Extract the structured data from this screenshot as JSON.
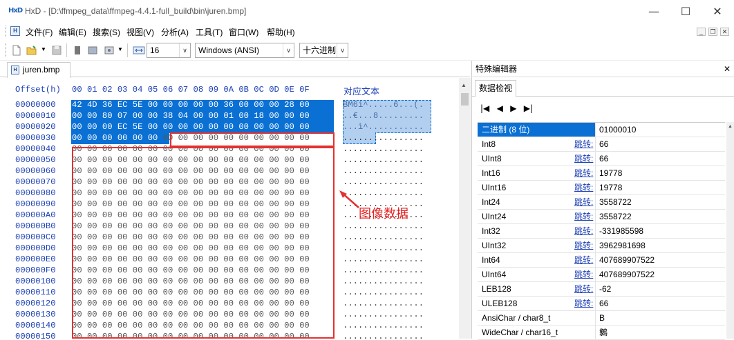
{
  "window": {
    "icon_label": "HxD",
    "title": "HxD - [D:\\ffmpeg_data\\ffmpeg-4.4.1-full_build\\bin\\juren.bmp]",
    "min_glyph": "—",
    "max_glyph": "☐",
    "close_glyph": "✕"
  },
  "menu": {
    "items": [
      "文件(F)",
      "编辑(E)",
      "搜索(S)",
      "视图(V)",
      "分析(A)",
      "工具(T)",
      "窗口(W)",
      "帮助(H)"
    ]
  },
  "toolbar": {
    "bytes_per_row": "16",
    "charset": "Windows (ANSI)",
    "offset_base": "十六进制"
  },
  "tab": {
    "filename": "juren.bmp"
  },
  "hex": {
    "header_offset": "Offset(h)",
    "header_columns": "00 01 02 03 04 05 06 07 08 09 0A 0B 0C 0D 0E 0F",
    "header_text": "对应文本",
    "rows": [
      {
        "offset": "00000000",
        "bytes": "42 4D 36 EC 5E 00 00 00 00 00 36 00 00 00 28 00",
        "ascii": "BM6ì^.....6...(."
      },
      {
        "offset": "00000010",
        "bytes": "00 00 80 07 00 00 38 04 00 00 01 00 18 00 00 00",
        "ascii": "..€...8........."
      },
      {
        "offset": "00000020",
        "bytes": "00 00 00 EC 5E 00 00 00 00 00 00 00 00 00 00 00",
        "ascii": "...ì^..........."
      },
      {
        "offset": "00000030",
        "bytes": "00 00 00 00 00 00 00 00 00 00 00 00 00 00 00 00",
        "ascii": "................"
      },
      {
        "offset": "00000040",
        "bytes": "00 00 00 00 00 00 00 00 00 00 00 00 00 00 00 00",
        "ascii": "................"
      },
      {
        "offset": "00000050",
        "bytes": "00 00 00 00 00 00 00 00 00 00 00 00 00 00 00 00",
        "ascii": "................"
      },
      {
        "offset": "00000060",
        "bytes": "00 00 00 00 00 00 00 00 00 00 00 00 00 00 00 00",
        "ascii": "................"
      },
      {
        "offset": "00000070",
        "bytes": "00 00 00 00 00 00 00 00 00 00 00 00 00 00 00 00",
        "ascii": "................"
      },
      {
        "offset": "00000080",
        "bytes": "00 00 00 00 00 00 00 00 00 00 00 00 00 00 00 00",
        "ascii": "................"
      },
      {
        "offset": "00000090",
        "bytes": "00 00 00 00 00 00 00 00 00 00 00 00 00 00 00 00",
        "ascii": "................"
      },
      {
        "offset": "000000A0",
        "bytes": "00 00 00 00 00 00 00 00 00 00 00 00 00 00 00 00",
        "ascii": "................"
      },
      {
        "offset": "000000B0",
        "bytes": "00 00 00 00 00 00 00 00 00 00 00 00 00 00 00 00",
        "ascii": "................"
      },
      {
        "offset": "000000C0",
        "bytes": "00 00 00 00 00 00 00 00 00 00 00 00 00 00 00 00",
        "ascii": "................"
      },
      {
        "offset": "000000D0",
        "bytes": "00 00 00 00 00 00 00 00 00 00 00 00 00 00 00 00",
        "ascii": "................"
      },
      {
        "offset": "000000E0",
        "bytes": "00 00 00 00 00 00 00 00 00 00 00 00 00 00 00 00",
        "ascii": "................"
      },
      {
        "offset": "000000F0",
        "bytes": "00 00 00 00 00 00 00 00 00 00 00 00 00 00 00 00",
        "ascii": "................"
      },
      {
        "offset": "00000100",
        "bytes": "00 00 00 00 00 00 00 00 00 00 00 00 00 00 00 00",
        "ascii": "................"
      },
      {
        "offset": "00000110",
        "bytes": "00 00 00 00 00 00 00 00 00 00 00 00 00 00 00 00",
        "ascii": "................"
      },
      {
        "offset": "00000120",
        "bytes": "00 00 00 00 00 00 00 00 00 00 00 00 00 00 00 00",
        "ascii": "................"
      },
      {
        "offset": "00000130",
        "bytes": "00 00 00 00 00 00 00 00 00 00 00 00 00 00 00 00",
        "ascii": "................"
      },
      {
        "offset": "00000140",
        "bytes": "00 00 00 00 00 00 00 00 00 00 00 00 00 00 00 00",
        "ascii": "................"
      },
      {
        "offset": "00000150",
        "bytes": "00 00 00 00 00 00 00 00 00 00 00 00 00 00 00 00",
        "ascii": "................"
      }
    ],
    "annotation": "图像数据"
  },
  "panel": {
    "title": "特殊编辑器",
    "close_glyph": "✕",
    "tab": "数据检视",
    "jump_label": "跳转:",
    "rows": [
      {
        "name": "二进制 (8 位)",
        "value": "01000010",
        "jump": false
      },
      {
        "name": "Int8",
        "value": "66",
        "jump": true
      },
      {
        "name": "UInt8",
        "value": "66",
        "jump": true
      },
      {
        "name": "Int16",
        "value": "19778",
        "jump": true
      },
      {
        "name": "UInt16",
        "value": "19778",
        "jump": true
      },
      {
        "name": "Int24",
        "value": "3558722",
        "jump": true
      },
      {
        "name": "UInt24",
        "value": "3558722",
        "jump": true
      },
      {
        "name": "Int32",
        "value": "-331985598",
        "jump": true
      },
      {
        "name": "UInt32",
        "value": "3962981698",
        "jump": true
      },
      {
        "name": "Int64",
        "value": "407689907522",
        "jump": true
      },
      {
        "name": "UInt64",
        "value": "407689907522",
        "jump": true
      },
      {
        "name": "LEB128",
        "value": "-62",
        "jump": true
      },
      {
        "name": "ULEB128",
        "value": "66",
        "jump": true
      },
      {
        "name": "AnsiChar / char8_t",
        "value": "B",
        "jump": false
      },
      {
        "name": "WideChar / char16_t",
        "value": "䴂",
        "jump": false
      }
    ]
  },
  "colors": {
    "selection": "#0a70d4",
    "annotation": "#e53030",
    "offset_text": "#1a3fb5"
  }
}
